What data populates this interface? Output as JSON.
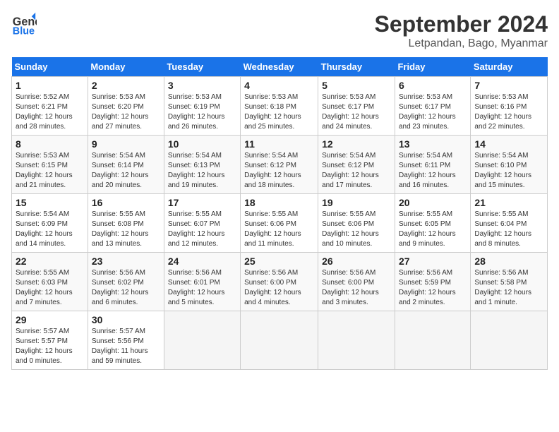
{
  "logo": {
    "line1": "General",
    "line2": "Blue"
  },
  "title": "September 2024",
  "location": "Letpandan, Bago, Myanmar",
  "headers": [
    "Sunday",
    "Monday",
    "Tuesday",
    "Wednesday",
    "Thursday",
    "Friday",
    "Saturday"
  ],
  "weeks": [
    [
      {
        "day": "1",
        "sunrise": "5:52 AM",
        "sunset": "6:21 PM",
        "daylight": "12 hours and 28 minutes."
      },
      {
        "day": "2",
        "sunrise": "5:53 AM",
        "sunset": "6:20 PM",
        "daylight": "12 hours and 27 minutes."
      },
      {
        "day": "3",
        "sunrise": "5:53 AM",
        "sunset": "6:19 PM",
        "daylight": "12 hours and 26 minutes."
      },
      {
        "day": "4",
        "sunrise": "5:53 AM",
        "sunset": "6:18 PM",
        "daylight": "12 hours and 25 minutes."
      },
      {
        "day": "5",
        "sunrise": "5:53 AM",
        "sunset": "6:17 PM",
        "daylight": "12 hours and 24 minutes."
      },
      {
        "day": "6",
        "sunrise": "5:53 AM",
        "sunset": "6:17 PM",
        "daylight": "12 hours and 23 minutes."
      },
      {
        "day": "7",
        "sunrise": "5:53 AM",
        "sunset": "6:16 PM",
        "daylight": "12 hours and 22 minutes."
      }
    ],
    [
      {
        "day": "8",
        "sunrise": "5:53 AM",
        "sunset": "6:15 PM",
        "daylight": "12 hours and 21 minutes."
      },
      {
        "day": "9",
        "sunrise": "5:54 AM",
        "sunset": "6:14 PM",
        "daylight": "12 hours and 20 minutes."
      },
      {
        "day": "10",
        "sunrise": "5:54 AM",
        "sunset": "6:13 PM",
        "daylight": "12 hours and 19 minutes."
      },
      {
        "day": "11",
        "sunrise": "5:54 AM",
        "sunset": "6:12 PM",
        "daylight": "12 hours and 18 minutes."
      },
      {
        "day": "12",
        "sunrise": "5:54 AM",
        "sunset": "6:12 PM",
        "daylight": "12 hours and 17 minutes."
      },
      {
        "day": "13",
        "sunrise": "5:54 AM",
        "sunset": "6:11 PM",
        "daylight": "12 hours and 16 minutes."
      },
      {
        "day": "14",
        "sunrise": "5:54 AM",
        "sunset": "6:10 PM",
        "daylight": "12 hours and 15 minutes."
      }
    ],
    [
      {
        "day": "15",
        "sunrise": "5:54 AM",
        "sunset": "6:09 PM",
        "daylight": "12 hours and 14 minutes."
      },
      {
        "day": "16",
        "sunrise": "5:55 AM",
        "sunset": "6:08 PM",
        "daylight": "12 hours and 13 minutes."
      },
      {
        "day": "17",
        "sunrise": "5:55 AM",
        "sunset": "6:07 PM",
        "daylight": "12 hours and 12 minutes."
      },
      {
        "day": "18",
        "sunrise": "5:55 AM",
        "sunset": "6:06 PM",
        "daylight": "12 hours and 11 minutes."
      },
      {
        "day": "19",
        "sunrise": "5:55 AM",
        "sunset": "6:06 PM",
        "daylight": "12 hours and 10 minutes."
      },
      {
        "day": "20",
        "sunrise": "5:55 AM",
        "sunset": "6:05 PM",
        "daylight": "12 hours and 9 minutes."
      },
      {
        "day": "21",
        "sunrise": "5:55 AM",
        "sunset": "6:04 PM",
        "daylight": "12 hours and 8 minutes."
      }
    ],
    [
      {
        "day": "22",
        "sunrise": "5:55 AM",
        "sunset": "6:03 PM",
        "daylight": "12 hours and 7 minutes."
      },
      {
        "day": "23",
        "sunrise": "5:56 AM",
        "sunset": "6:02 PM",
        "daylight": "12 hours and 6 minutes."
      },
      {
        "day": "24",
        "sunrise": "5:56 AM",
        "sunset": "6:01 PM",
        "daylight": "12 hours and 5 minutes."
      },
      {
        "day": "25",
        "sunrise": "5:56 AM",
        "sunset": "6:00 PM",
        "daylight": "12 hours and 4 minutes."
      },
      {
        "day": "26",
        "sunrise": "5:56 AM",
        "sunset": "6:00 PM",
        "daylight": "12 hours and 3 minutes."
      },
      {
        "day": "27",
        "sunrise": "5:56 AM",
        "sunset": "5:59 PM",
        "daylight": "12 hours and 2 minutes."
      },
      {
        "day": "28",
        "sunrise": "5:56 AM",
        "sunset": "5:58 PM",
        "daylight": "12 hours and 1 minute."
      }
    ],
    [
      {
        "day": "29",
        "sunrise": "5:57 AM",
        "sunset": "5:57 PM",
        "daylight": "12 hours and 0 minutes."
      },
      {
        "day": "30",
        "sunrise": "5:57 AM",
        "sunset": "5:56 PM",
        "daylight": "11 hours and 59 minutes."
      },
      null,
      null,
      null,
      null,
      null
    ]
  ]
}
